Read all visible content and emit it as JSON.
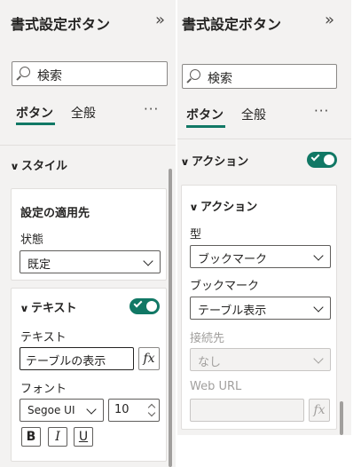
{
  "left": {
    "title": "書式設定ボタン",
    "expand_glyph": "»",
    "search_placeholder": "検索",
    "tabs": [
      {
        "label": "ボタン",
        "active": true
      },
      {
        "label": "全般",
        "active": false
      }
    ],
    "more_glyph": "···",
    "style_section": {
      "label": "スタイル"
    },
    "apply_card": {
      "title": "設定の適用先",
      "state_label": "状態",
      "state_value": "既定"
    },
    "text_card": {
      "header": "テキスト",
      "toggle_on": true,
      "text_label": "テキスト",
      "text_value": "テーブルの表示",
      "fx": "fx",
      "font_label": "フォント",
      "font_family": "Segoe UI",
      "font_size": "10",
      "bold": "B",
      "italic": "I",
      "underline": "U"
    }
  },
  "right": {
    "title": "書式設定ボタン",
    "expand_glyph": "»",
    "search_placeholder": "検索",
    "tabs": [
      {
        "label": "ボタン",
        "active": true
      },
      {
        "label": "全般",
        "active": false
      }
    ],
    "more_glyph": "···",
    "action_section": {
      "label": "アクション",
      "toggle_on": true
    },
    "action_card": {
      "title": "アクション",
      "type_label": "型",
      "type_value": "ブックマーク",
      "bookmark_label": "ブックマーク",
      "bookmark_value": "テーブル表示",
      "dest_label": "接続先",
      "dest_value": "なし",
      "weburl_label": "Web URL",
      "fx": "fx"
    }
  },
  "colors": {
    "accent": "#117865",
    "panel_bg": "#f3f2f1"
  }
}
